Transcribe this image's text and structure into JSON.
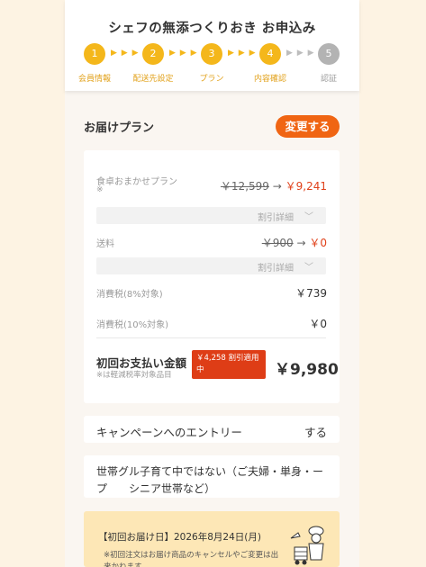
{
  "header": {
    "title": "シェフの無添つくりおき お申込み",
    "steps": [
      {
        "num": "1",
        "label": "会員情報"
      },
      {
        "num": "2",
        "label": "配送先設定"
      },
      {
        "num": "3",
        "label": "プラン"
      },
      {
        "num": "4",
        "label": "内容確認"
      },
      {
        "num": "5",
        "label": "認証"
      }
    ],
    "arrow_glyphs": "▶ ▶ ▶"
  },
  "plan_section": {
    "title": "お届けプラン",
    "change_button": "変更する"
  },
  "plan_card": {
    "plan_name": "食卓おまかせプラン",
    "plan_mark": "※",
    "plan_old_price": "￥12,599",
    "plan_arrow": "→",
    "plan_new_price": "￥9,241",
    "discount_detail": "割引詳細",
    "shipping_label": "送料",
    "shipping_old": "￥900",
    "shipping_arrow": "→",
    "shipping_new": "￥0",
    "tax8_label": "消費税(8%対象)",
    "tax8_value": "￥739",
    "tax10_label": "消費税(10%対象)",
    "tax10_value": "￥0",
    "total_label": "初回お支払い金額",
    "total_note": "※は軽減税率対象品目",
    "discount_badge": "￥4,258 割引適用中",
    "total_value": "￥9,980"
  },
  "campaign": {
    "label": "キャンペーンへのエントリー",
    "value": "する"
  },
  "household": {
    "text": "世帯グル子育て中ではない（ご夫婦・単身・ープ　　シニア世帯など）"
  },
  "delivery": {
    "date_text": "【初回お届け日】2026年8月24日(月)",
    "note": "※初回注文はお届け商品のキャンセルやご変更は出来かねます。"
  },
  "colors": {
    "accent_yellow": "#f4b71b",
    "accent_orange": "#f06513",
    "price_red": "#e0411a",
    "inactive_grey": "#b3b3b3",
    "background": "#fdf3e3"
  },
  "icons": {
    "dropdown": "chevron-down-icon",
    "illustration": "chef-delivery-illustration"
  }
}
